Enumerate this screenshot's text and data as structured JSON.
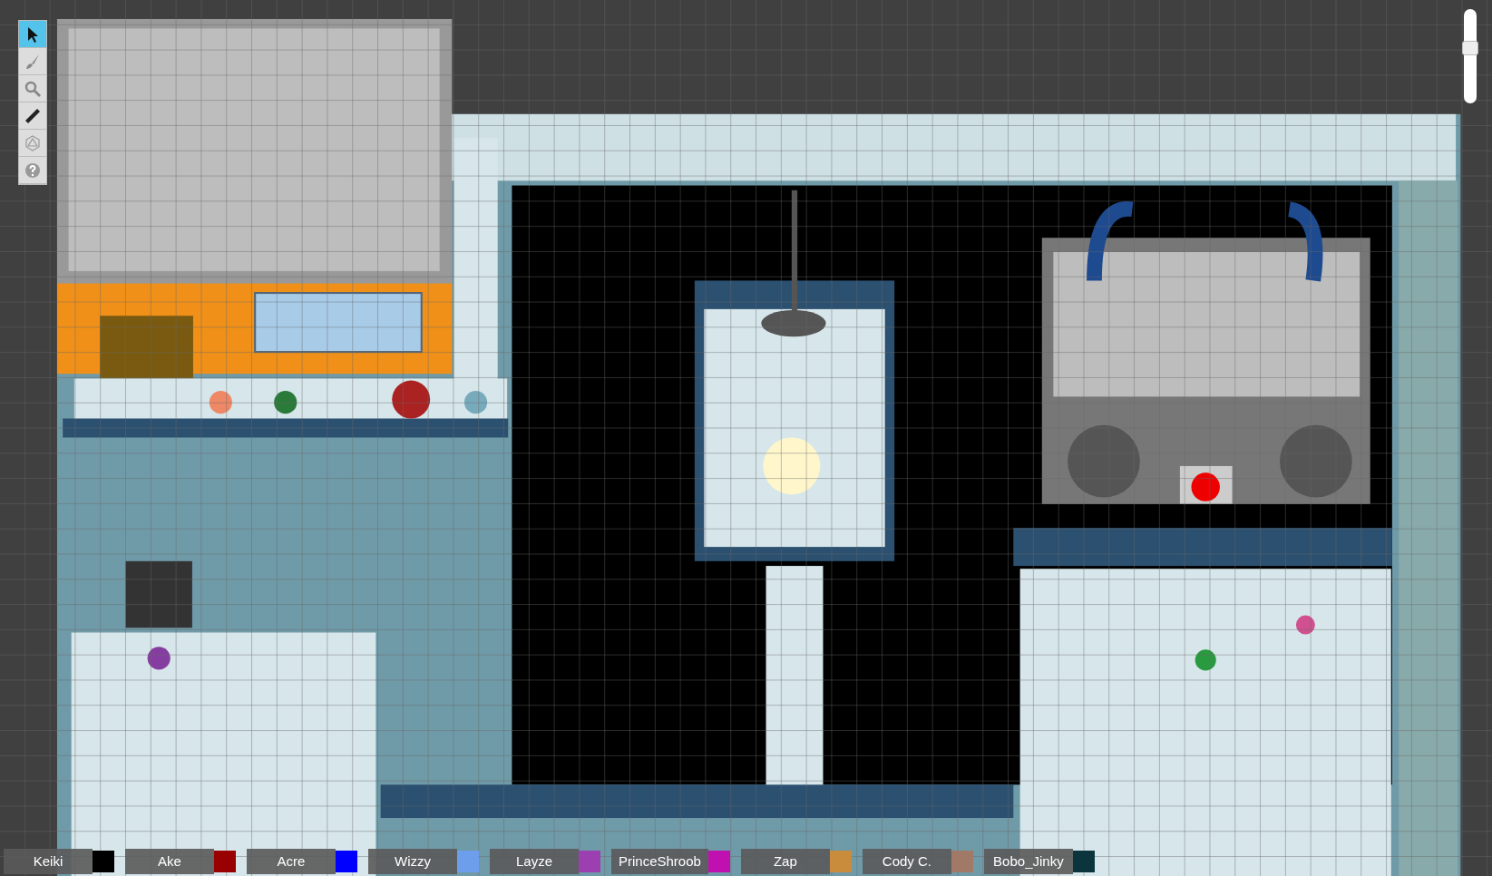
{
  "toolbar": {
    "tools": [
      {
        "kind": "select",
        "selected": true
      },
      {
        "kind": "brush",
        "selected": false
      },
      {
        "kind": "zoom",
        "selected": false
      },
      {
        "kind": "ruler",
        "selected": false
      },
      {
        "kind": "dice",
        "selected": false
      },
      {
        "kind": "help",
        "selected": false
      }
    ]
  },
  "zoom_slider": {
    "level": 0.6
  },
  "players": [
    {
      "name": "Keiki",
      "color": "#000000"
    },
    {
      "name": "Ake",
      "color": "#990000"
    },
    {
      "name": "Acre",
      "color": "#0000ff"
    },
    {
      "name": "Wizzy",
      "color": "#6d9eeb"
    },
    {
      "name": "Layze",
      "color": "#9c3fb0"
    },
    {
      "name": "PrinceShroob",
      "color": "#c010b0"
    },
    {
      "name": "Zap",
      "color": "#c98c3c"
    },
    {
      "name": "Cody C.",
      "color": "#a07a66"
    },
    {
      "name": "Bobo_Jinky",
      "color": "#0c343d"
    }
  ]
}
